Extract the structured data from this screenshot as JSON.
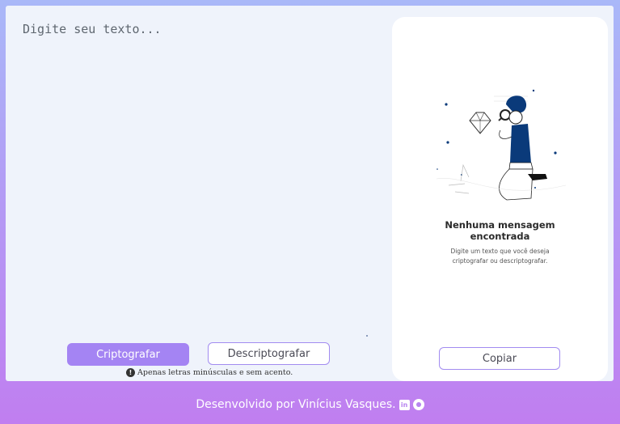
{
  "input": {
    "placeholder": "Digite seu texto..."
  },
  "buttons": {
    "encrypt_label": "Criptografar",
    "decrypt_label": "Descriptografar",
    "copy_label": "Copiar"
  },
  "warning": {
    "icon": "info-icon",
    "text": "Apenas letras minúsculas e sem acento."
  },
  "output": {
    "title_line1": "Nenhuma mensagem",
    "title_line2": "encontrada",
    "desc_line1": "Digite um texto que você deseja",
    "desc_line2": "criptografar ou descriptografar."
  },
  "footer": {
    "text": "Desenvolvido por Vinícius Vasques.",
    "icons": [
      "linkedin-icon",
      "github-icon"
    ]
  },
  "colors": {
    "accent": "#a484f3",
    "card_bg": "#eff3fb",
    "output_bg": "#ffffff",
    "figure_blue": "#0a3a7a"
  }
}
